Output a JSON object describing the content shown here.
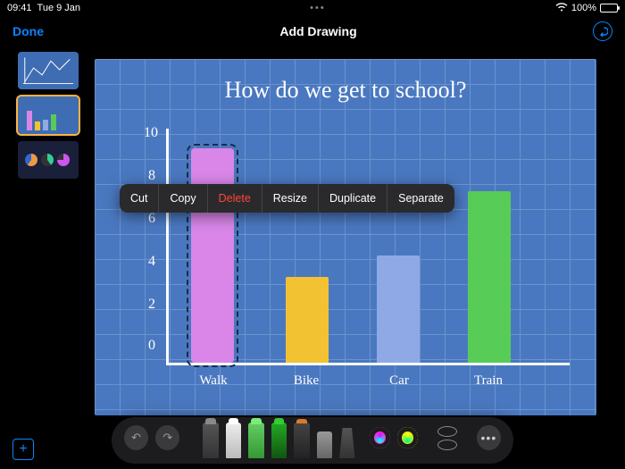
{
  "status": {
    "time": "09:41",
    "date": "Tue 9 Jan",
    "battery_pct": "100%"
  },
  "toolbar": {
    "done": "Done",
    "title": "Add Drawing"
  },
  "context_menu": {
    "cut": "Cut",
    "copy": "Copy",
    "delete": "Delete",
    "resize": "Resize",
    "duplicate": "Duplicate",
    "separate": "Separate"
  },
  "chart_data": {
    "type": "bar",
    "title": "How do we get to school?",
    "categories": [
      "Walk",
      "Bike",
      "Car",
      "Train"
    ],
    "values": [
      10,
      4,
      5,
      8
    ],
    "y_ticks": [
      0,
      2,
      4,
      6,
      8,
      10
    ],
    "ylim": [
      0,
      10
    ],
    "colors": [
      "#d986e8",
      "#f2c233",
      "#8fa9e6",
      "#57cc57"
    ],
    "selected_index": 0
  },
  "sidebar": {
    "slide_count": 3,
    "selected": 2
  },
  "palette": {
    "tools": [
      "pen-gray",
      "pen-white",
      "pen-green-light",
      "pen-green",
      "marker-orange",
      "eraser",
      "ruler"
    ],
    "colors": [
      "#ff2ec4",
      "#ffe500"
    ]
  }
}
